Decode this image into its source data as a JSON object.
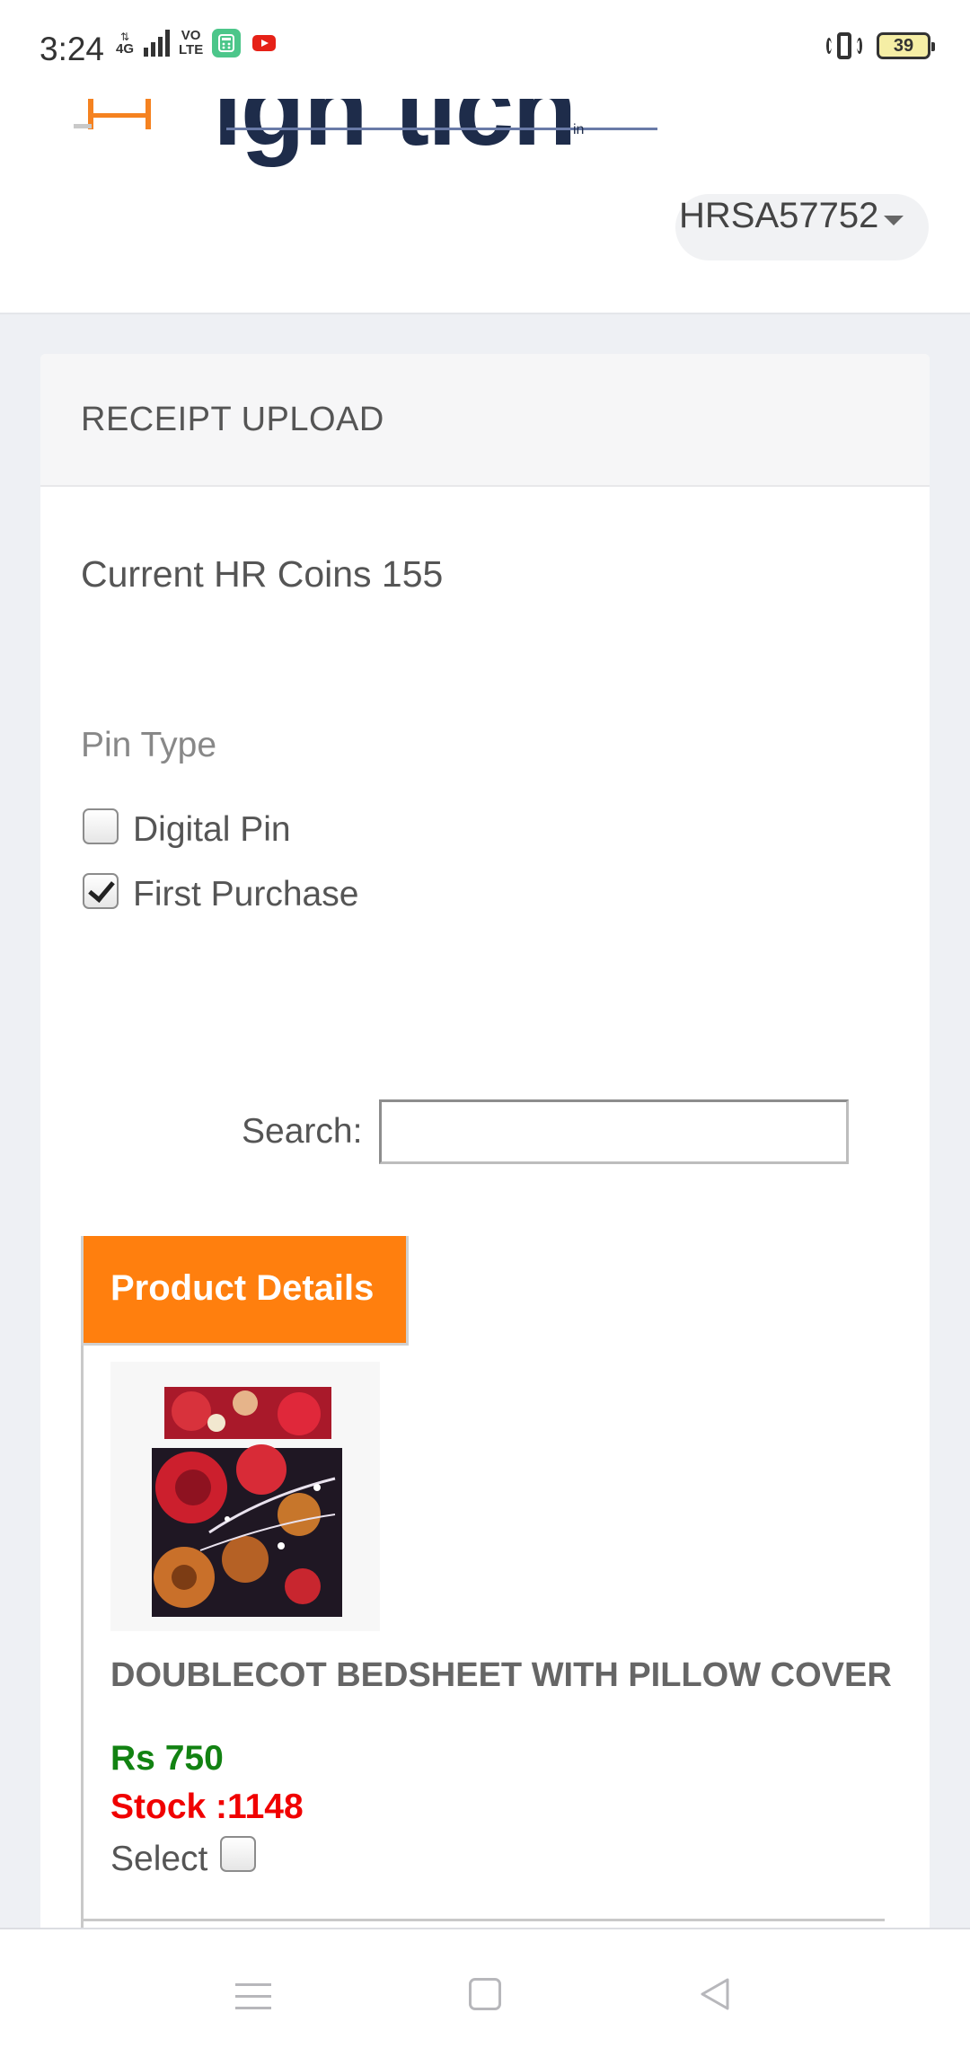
{
  "status_bar": {
    "time": "3:24",
    "network": "4G",
    "volte": "VO\nLTE",
    "battery": "39"
  },
  "header": {
    "logo_text": "igh tich",
    "logo_suffix": "in",
    "user_id": "HRSA57752"
  },
  "card": {
    "title": "RECEIPT UPLOAD",
    "coins_text": "Current HR Coins 155",
    "pin_type_label": "Pin Type",
    "pin_options": [
      {
        "label": "Digital Pin",
        "checked": false
      },
      {
        "label": "First Purchase",
        "checked": true
      }
    ],
    "search_label": "Search:",
    "search_value": ""
  },
  "table": {
    "header": "Product Details",
    "product": {
      "name": "DOUBLECOT BEDSHEET WITH PILLOW COVER",
      "price": "Rs 750",
      "stock": "Stock :1148",
      "select_label": "Select",
      "selected": false
    }
  },
  "colors": {
    "accent": "#ff7f0e",
    "price": "#128212",
    "stock": "#f00000",
    "logo_orange": "#f58220",
    "logo_navy": "#1e2c4a"
  },
  "icons": [
    "sort-arrows-icon",
    "signal-icon",
    "calculator-app-icon",
    "youtube-icon",
    "vibrate-icon",
    "battery-icon",
    "caret-down-icon",
    "menu-icon",
    "home-icon",
    "back-icon"
  ]
}
